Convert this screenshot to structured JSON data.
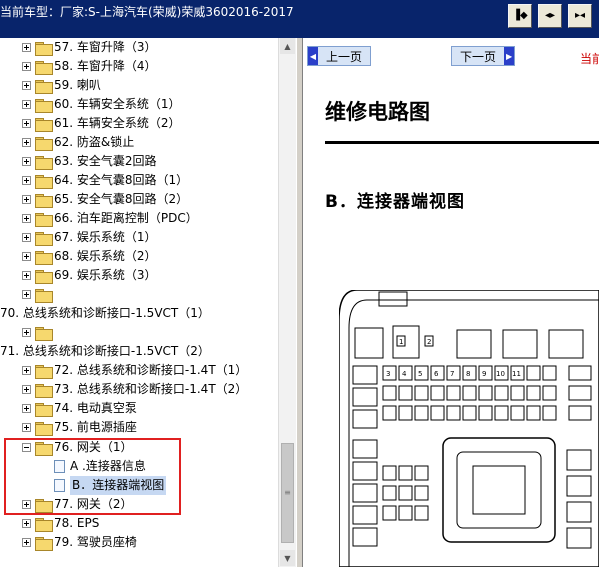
{
  "titlebar": {
    "title": "当前车型：厂家:S-上海汽车(荣威)荣威3602016-2017",
    "buttons": [
      {
        "icon": "dock-right-icon"
      },
      {
        "icon": "expand-horizontal-icon"
      },
      {
        "icon": "collapse-horizontal-icon"
      }
    ]
  },
  "tree": {
    "items": [
      {
        "label": "57. 车窗升降（3）"
      },
      {
        "label": "58. 车窗升降（4）"
      },
      {
        "label": "59. 喇叭"
      },
      {
        "label": "60. 车辆安全系统（1）"
      },
      {
        "label": "61. 车辆安全系统（2）"
      },
      {
        "label": "62. 防盗&锁止"
      },
      {
        "label": "63. 安全气囊2回路"
      },
      {
        "label": "64. 安全气囊8回路（1）"
      },
      {
        "label": "65. 安全气囊8回路（2）"
      },
      {
        "label": "66. 泊车距离控制（PDC）"
      },
      {
        "label": "67. 娱乐系统（1）"
      },
      {
        "label": "68. 娱乐系统（2）"
      },
      {
        "label": "69. 娱乐系统（3）"
      },
      {
        "label": ""
      },
      {
        "label": "70. 总线系统和诊断接口-1.5VCT（1）"
      },
      {
        "label": ""
      },
      {
        "label": "71. 总线系统和诊断接口-1.5VCT（2）"
      },
      {
        "label": "72. 总线系统和诊断接口-1.4T（1）"
      },
      {
        "label": "73. 总线系统和诊断接口-1.4T（2）"
      },
      {
        "label": "74. 电动真空泵"
      },
      {
        "label": "75. 前电源插座"
      },
      {
        "label": "76. 网关（1）"
      },
      {
        "label": "A .连接器信息"
      },
      {
        "label": "B．连接器端视图"
      },
      {
        "label": "77. 网关（2）"
      },
      {
        "label": "78. EPS"
      },
      {
        "label": "79. 驾驶员座椅"
      }
    ]
  },
  "nav": {
    "prev_label": "上一页",
    "next_label": "下一页",
    "current_label": "当前"
  },
  "document": {
    "heading": "维修电路图",
    "subheading": "B．连接器端视图",
    "connector_pins": [
      "1",
      "2",
      "3",
      "4",
      "5",
      "6",
      "7",
      "8",
      "9",
      "10",
      "11"
    ]
  },
  "colors": {
    "titlebar_bg": "#08246b",
    "selection_bg": "#c6d8f2",
    "highlight": "#e02020",
    "nav_arrow": "#2a3fc9",
    "current_page_text": "#cc0000"
  }
}
